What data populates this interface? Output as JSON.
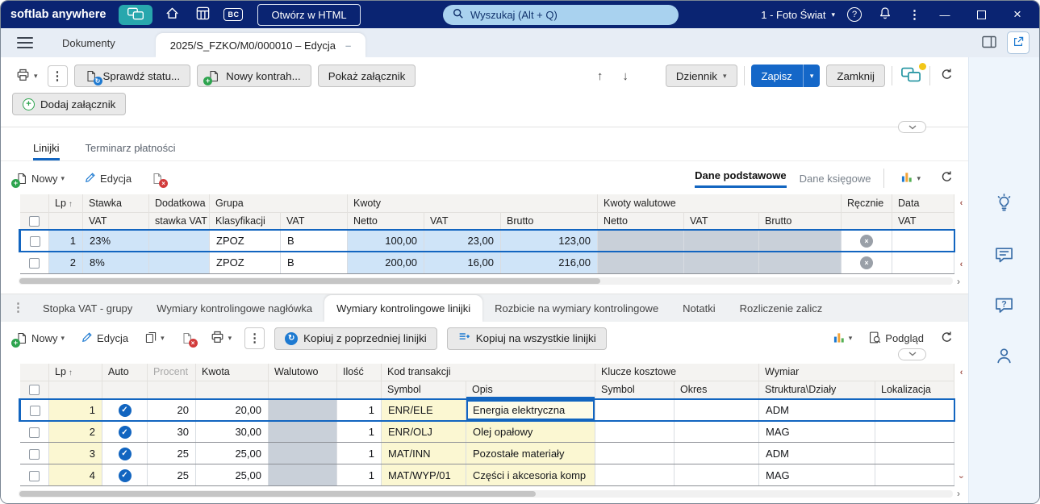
{
  "titlebar": {
    "app_name": "softlab anywhere",
    "open_html": "Otwórz w HTML",
    "search_placeholder": "Wyszukaj (Alt + Q)",
    "company": "1 - Foto Świat"
  },
  "tabs": {
    "documents": "Dokumenty",
    "active_doc": "2025/S_FZKO/M0/000010 – Edycja"
  },
  "toolbar": {
    "check_status": "Sprawdź statu...",
    "new_contractor": "Nowy kontrah...",
    "show_attachment": "Pokaż załącznik",
    "journal": "Dziennik",
    "save": "Zapisz",
    "close_btn": "Zamknij",
    "add_attachment": "Dodaj załącznik"
  },
  "lines": {
    "tab_lines": "Linijki",
    "tab_schedule": "Terminarz płatności",
    "new": "Nowy",
    "edit": "Edycja",
    "view_basic": "Dane podstawowe",
    "view_accounting": "Dane księgowe",
    "table": {
      "h1": {
        "lp": "Lp",
        "stawka": "Stawka",
        "dodatkowa": "Dodatkowa",
        "grupa": "Grupa",
        "kwoty": "Kwoty",
        "kwoty_walutowe": "Kwoty walutowe",
        "recznie": "Ręcznie",
        "data": "Data"
      },
      "h2": {
        "vat_a": "VAT",
        "stawka_vat": "stawka VAT",
        "klasyfikacji": "Klasyfikacji",
        "vat_b": "VAT",
        "netto": "Netto",
        "vat_c": "VAT",
        "brutto": "Brutto",
        "netto_w": "Netto",
        "vat_w": "VAT",
        "brutto_w": "Brutto",
        "vat_d": "VAT"
      },
      "rows": [
        {
          "lp": "1",
          "stawka_vat": "23%",
          "dodatkowa": "",
          "klasyfikacji": "ZPOZ",
          "grupa_vat": "B",
          "netto": "100,00",
          "vat": "23,00",
          "brutto": "123,00",
          "netto_w": "",
          "vat_w": "",
          "brutto_w": "",
          "data_vat": ""
        },
        {
          "lp": "2",
          "stawka_vat": "8%",
          "dodatkowa": "",
          "klasyfikacji": "ZPOZ",
          "grupa_vat": "B",
          "netto": "200,00",
          "vat": "16,00",
          "brutto": "216,00",
          "netto_w": "",
          "vat_w": "",
          "brutto_w": "",
          "data_vat": ""
        }
      ]
    }
  },
  "bottom_tabs": {
    "stopka": "Stopka VAT - grupy",
    "wym_naglowka": "Wymiary kontrolingowe nagłówka",
    "wym_linijki": "Wymiary kontrolingowe linijki",
    "rozbicie": "Rozbicie na wymiary kontrolingowe",
    "notatki": "Notatki",
    "rozliczenie": "Rozliczenie zalicz"
  },
  "dims": {
    "new": "Nowy",
    "edit": "Edycja",
    "copy_prev": "Kopiuj z poprzedniej linijki",
    "copy_all": "Kopiuj na wszystkie linijki",
    "preview": "Podgląd",
    "table": {
      "h1": {
        "lp": "Lp",
        "auto": "Auto",
        "procent": "Procent",
        "kwota": "Kwota",
        "walutowo": "Walutowo",
        "ilosc": "Ilość",
        "kod": "Kod transakcji",
        "klucze": "Klucze kosztowe",
        "wymiar": "Wymiar"
      },
      "h2": {
        "symbol_kod": "Symbol",
        "opis": "Opis",
        "symbol_klucze": "Symbol",
        "okres": "Okres",
        "struktura": "Struktura\\Działy",
        "lokalizacja": "Lokalizacja"
      },
      "rows": [
        {
          "lp": "1",
          "procent": "20",
          "kwota": "20,00",
          "walutowo": "",
          "ilosc": "1",
          "symbol": "ENR/ELE",
          "opis": "Energia elektryczna",
          "ksymbol": "",
          "okres": "",
          "struktura": "ADM",
          "lokalizacja": ""
        },
        {
          "lp": "2",
          "procent": "30",
          "kwota": "30,00",
          "walutowo": "",
          "ilosc": "1",
          "symbol": "ENR/OLJ",
          "opis": "Olej opałowy",
          "ksymbol": "",
          "okres": "",
          "struktura": "MAG",
          "lokalizacja": ""
        },
        {
          "lp": "3",
          "procent": "25",
          "kwota": "25,00",
          "walutowo": "",
          "ilosc": "1",
          "symbol": "MAT/INN",
          "opis": "Pozostałe materiały",
          "ksymbol": "",
          "okres": "",
          "struktura": "ADM",
          "lokalizacja": ""
        },
        {
          "lp": "4",
          "procent": "25",
          "kwota": "25,00",
          "walutowo": "",
          "ilosc": "1",
          "symbol": "MAT/WYP/01",
          "opis": "Części i akcesoria komp",
          "ksymbol": "",
          "okres": "",
          "struktura": "MAG",
          "lokalizacja": ""
        }
      ]
    }
  },
  "icons": {
    "caret_down": "▾",
    "kebab": "⋮",
    "up": "↑",
    "down": "↓",
    "sort_asc": "↑",
    "help": "?",
    "close": "×",
    "minimize": "—",
    "check": "✓",
    "x_mark": "×",
    "dash": "–",
    "chevron_left": "‹",
    "chevron_right": "›",
    "rotate": "↻"
  },
  "colors": {
    "navy": "#0a2472",
    "teal": "#28a7ad",
    "accent_blue": "#1265c0",
    "cell_blue": "#cfe4f8",
    "cell_gray": "#c9d0d9",
    "cell_yellow": "#fbf7d2",
    "notification_yellow": "#f2c618"
  }
}
